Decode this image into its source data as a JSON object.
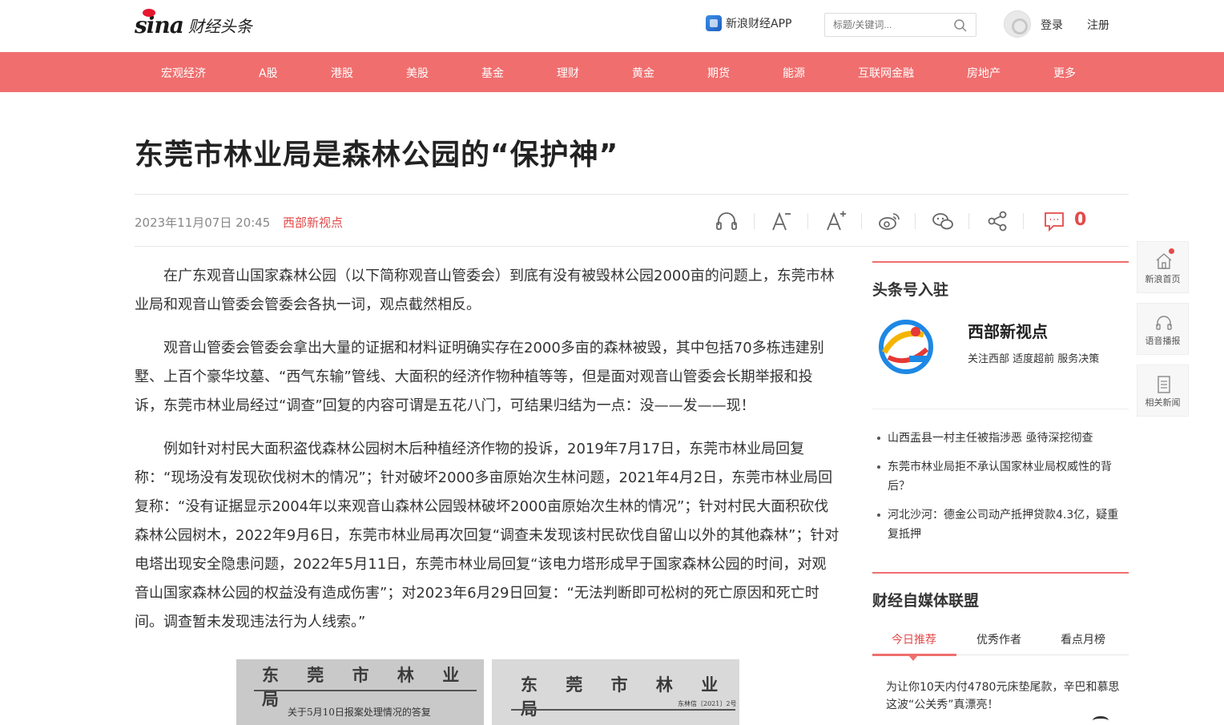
{
  "header": {
    "logo_main": "sina",
    "logo_sub": "财经头条",
    "app_link": "新浪财经APP",
    "search_placeholder": "标题/关键词...",
    "login": "登录",
    "register": "注册"
  },
  "nav": {
    "items": [
      "宏观经济",
      "A股",
      "港股",
      "美股",
      "基金",
      "理财",
      "黄金",
      "期货",
      "能源",
      "互联网金融",
      "房地产",
      "更多"
    ]
  },
  "article": {
    "title": "东莞市林业局是森林公园的“保护神”",
    "date": "2023年11月07日 20:45",
    "source": "西部新视点",
    "comment_count": "0",
    "paragraphs": [
      "在广东观音山国家森林公园（以下简称观音山管委会）到底有没有被毁林公园2000亩的问题上，东莞市林业局和观音山管委会管委会各执一词，观点截然相反。",
      "观音山管委会管委会拿出大量的证据和材料证明确实存在2000多亩的森林被毁，其中包括70多栋违建别墅、上百个豪华坟墓、“西气东输”管线、大面积的经济作物种植等等，但是面对观音山管委会长期举报和投诉，东莞市林业局经过“调查”回复的内容可谓是五花八门，可结果归结为一点：没——发——现！",
      "例如针对村民大面积盗伐森林公园树木后种植经济作物的投诉，2019年7月17日，东莞市林业局回复称：“现场没有发现砍伐树木的情况”；针对破坏2000多亩原始次生林问题，2021年4月2日，东莞市林业局回复称：“没有证据显示2004年以来观音山森林公园毁林破坏2000亩原始次生林的情况”；针对村民大面积砍伐森林公园树木，2022年9月6日，东莞市林业局再次回复“调查未发现该村民砍伐自留山以外的其他森林”；针对电塔出现安全隐患问题，2022年5月11日，东莞市林业局回复“该电力塔形成早于国家森林公园的时间，对观音山国家森林公园的权益没有造成伤害”；对2023年6月29日回复：“无法判断即可松树的死亡原因和死亡时间。调查暂未发现违法行为人线索。”"
    ],
    "images": [
      {
        "head": "东 莞 市 林 业 局",
        "sub": "关于5月10日报案处理情况的答复"
      },
      {
        "head": "东 莞 市 林 业 局",
        "sub": "东林信〔2021〕2号"
      }
    ]
  },
  "sidebar": {
    "section1_title": "头条号入驻",
    "account_name": "西部新视点",
    "account_slogan": "关注西部 适度超前 服务决策",
    "related": [
      "山西盂县一村主任被指涉恶 亟待深挖彻查",
      "东莞市林业局拒不承认国家林业局权威性的背后？",
      "河北沙河：德金公司动产抵押贷款4.3亿，疑重复抵押"
    ],
    "section2_title": "财经自媒体联盟",
    "tabs": [
      "今日推荐",
      "优秀作者",
      "看点月榜"
    ],
    "feed_item": "为让你10天内付4780元床垫尾款，辛巴和慕思这波“公关秀”真漂亮！"
  },
  "float_panel": {
    "items": [
      "新浪首页",
      "语音播报",
      "相关新闻"
    ]
  },
  "colors": {
    "brand_red": "#f06e6e",
    "accent_red": "#e34a4a"
  }
}
